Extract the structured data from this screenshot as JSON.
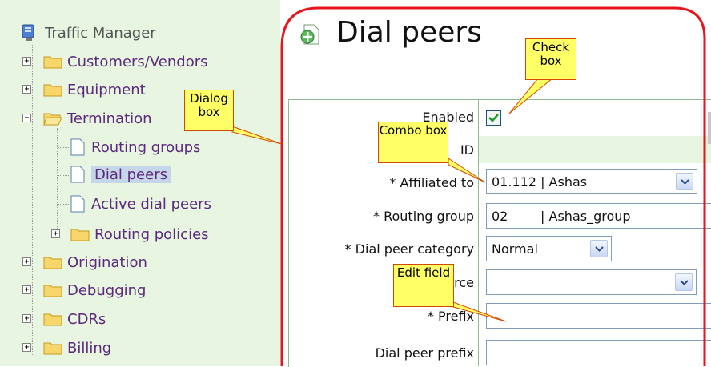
{
  "sidebar": {
    "root": "Traffic Manager",
    "items": [
      {
        "label": "Customers/Vendors"
      },
      {
        "label": "Equipment"
      },
      {
        "label": "Termination"
      },
      {
        "label": "Routing groups"
      },
      {
        "label": "Dial peers"
      },
      {
        "label": "Active dial peers"
      },
      {
        "label": "Routing policies"
      },
      {
        "label": "Origination"
      },
      {
        "label": "Debugging"
      },
      {
        "label": "CDRs"
      },
      {
        "label": "Billing"
      }
    ]
  },
  "page": {
    "title": "Dial peers"
  },
  "form": {
    "enabled_label": "Enabled",
    "id_label": "ID",
    "affiliated_label": "* Affiliated to",
    "affiliated_value": "01.112 | Ashas",
    "routing_group_label": "* Routing group",
    "routing_group_value": "02        | Ashas_group",
    "category_label": "* Dial peer category",
    "category_value": "Normal",
    "peer_source_label": "Peer source",
    "prefix_label": "* Prefix",
    "dial_peer_prefix_label": "Dial peer prefix"
  },
  "callouts": {
    "dialog": "Dialog box",
    "check": "Check box",
    "combo": "Combo box",
    "edit": "Edit field"
  },
  "colors": {
    "callout_fill": "#ffff66",
    "callout_border": "#d24a00",
    "highlight_outline": "#e8141b",
    "sidebar_bg": "#e8f5e1",
    "link_purple": "#5b2a7c"
  }
}
